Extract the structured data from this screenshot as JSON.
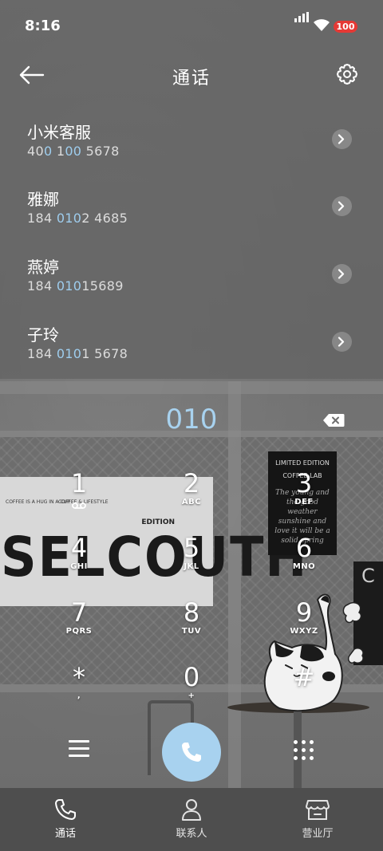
{
  "status_bar": {
    "time": "8:16",
    "battery": "100"
  },
  "header": {
    "title": "通话"
  },
  "contacts": [
    {
      "name": "小米客服",
      "num_pre": "40",
      "num_hl1": "0",
      "num_mid": " 1",
      "num_hl2": "00",
      "num_post": " 5678"
    },
    {
      "name": "雅娜",
      "num_pre": "184 ",
      "num_hl1": "010",
      "num_mid": "",
      "num_hl2": "",
      "num_post": "2 4685"
    },
    {
      "name": "燕婷",
      "num_pre": "184 ",
      "num_hl1": "010",
      "num_mid": "",
      "num_hl2": "",
      "num_post": "15689"
    },
    {
      "name": "子玲",
      "num_pre": "184 ",
      "num_hl1": "010",
      "num_mid": "",
      "num_hl2": "",
      "num_post": "1 5678"
    }
  ],
  "dialer": {
    "dialed_number": "010",
    "keys": [
      {
        "digit": "1",
        "letters": ""
      },
      {
        "digit": "2",
        "letters": "ABC"
      },
      {
        "digit": "3",
        "letters": "DEF"
      },
      {
        "digit": "4",
        "letters": "GHI"
      },
      {
        "digit": "5",
        "letters": "JKL"
      },
      {
        "digit": "6",
        "letters": "MNO"
      },
      {
        "digit": "7",
        "letters": "PQRS"
      },
      {
        "digit": "8",
        "letters": "TUV"
      },
      {
        "digit": "9",
        "letters": "WXYZ"
      },
      {
        "digit": "*",
        "letters": ","
      },
      {
        "digit": "0",
        "letters": "+"
      },
      {
        "digit": "#",
        "letters": ""
      }
    ]
  },
  "wallpaper": {
    "poster_text": "SELCOUTH",
    "poster_small_1": "COFFEE\nIS A HUG IN A CUP",
    "poster_small_2": "COFFEE\n& LIFESTYLE",
    "poster_edition": "EDITION",
    "board_title_1": "LIMITED EDITION",
    "board_title_2": "COFFEE LAB",
    "board_script": "The young and the good weather sunshine and love it will be a solid spring",
    "side_letter": "C"
  },
  "bottom_nav": [
    {
      "label": "通话",
      "icon": "phone-icon"
    },
    {
      "label": "联系人",
      "icon": "person-icon"
    },
    {
      "label": "营业厅",
      "icon": "store-icon"
    }
  ],
  "colors": {
    "accent": "#a8d2ef",
    "battery": "#e53935",
    "nav_bg": "#4e4e4e"
  }
}
